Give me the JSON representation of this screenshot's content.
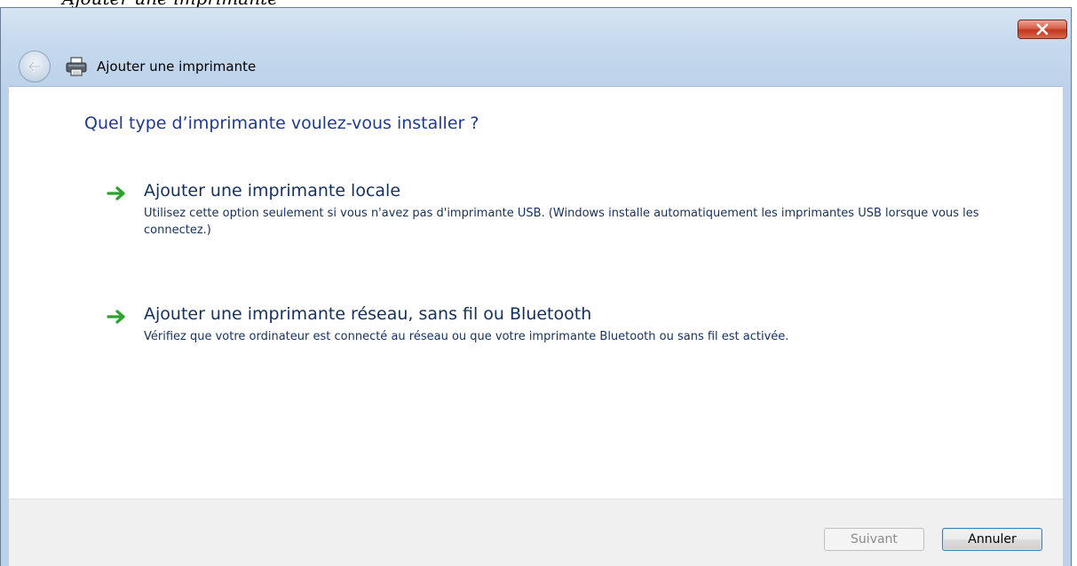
{
  "caption": {
    "text": "Ajouter une imprimante"
  },
  "window": {
    "title": "Ajouter une imprimante",
    "icons": {
      "back": "back-arrow-icon",
      "app": "printer-icon",
      "close": "close-icon"
    }
  },
  "main": {
    "question": "Quel type d’imprimante voulez-vous installer ?",
    "options": [
      {
        "title": "Ajouter une imprimante locale",
        "description": "Utilisez cette option seulement si vous n'avez pas d'imprimante USB. (Windows installe automatiquement les imprimantes USB lorsque vous les connectez.)",
        "icon": "green-arrow-icon"
      },
      {
        "title": "Ajouter une imprimante réseau, sans fil ou Bluetooth",
        "description": "Vérifiez que votre ordinateur est connecté au réseau ou que votre imprimante Bluetooth ou sans fil est activée.",
        "icon": "green-arrow-icon"
      }
    ]
  },
  "footer": {
    "next_label": "Suivant",
    "next_enabled": false,
    "cancel_label": "Annuler"
  },
  "colors": {
    "heading": "#1f3a93",
    "option_text": "#14305f",
    "arrow": "#2fa12f",
    "frame": "#bcd2ea",
    "close_button": "#c2351d"
  }
}
